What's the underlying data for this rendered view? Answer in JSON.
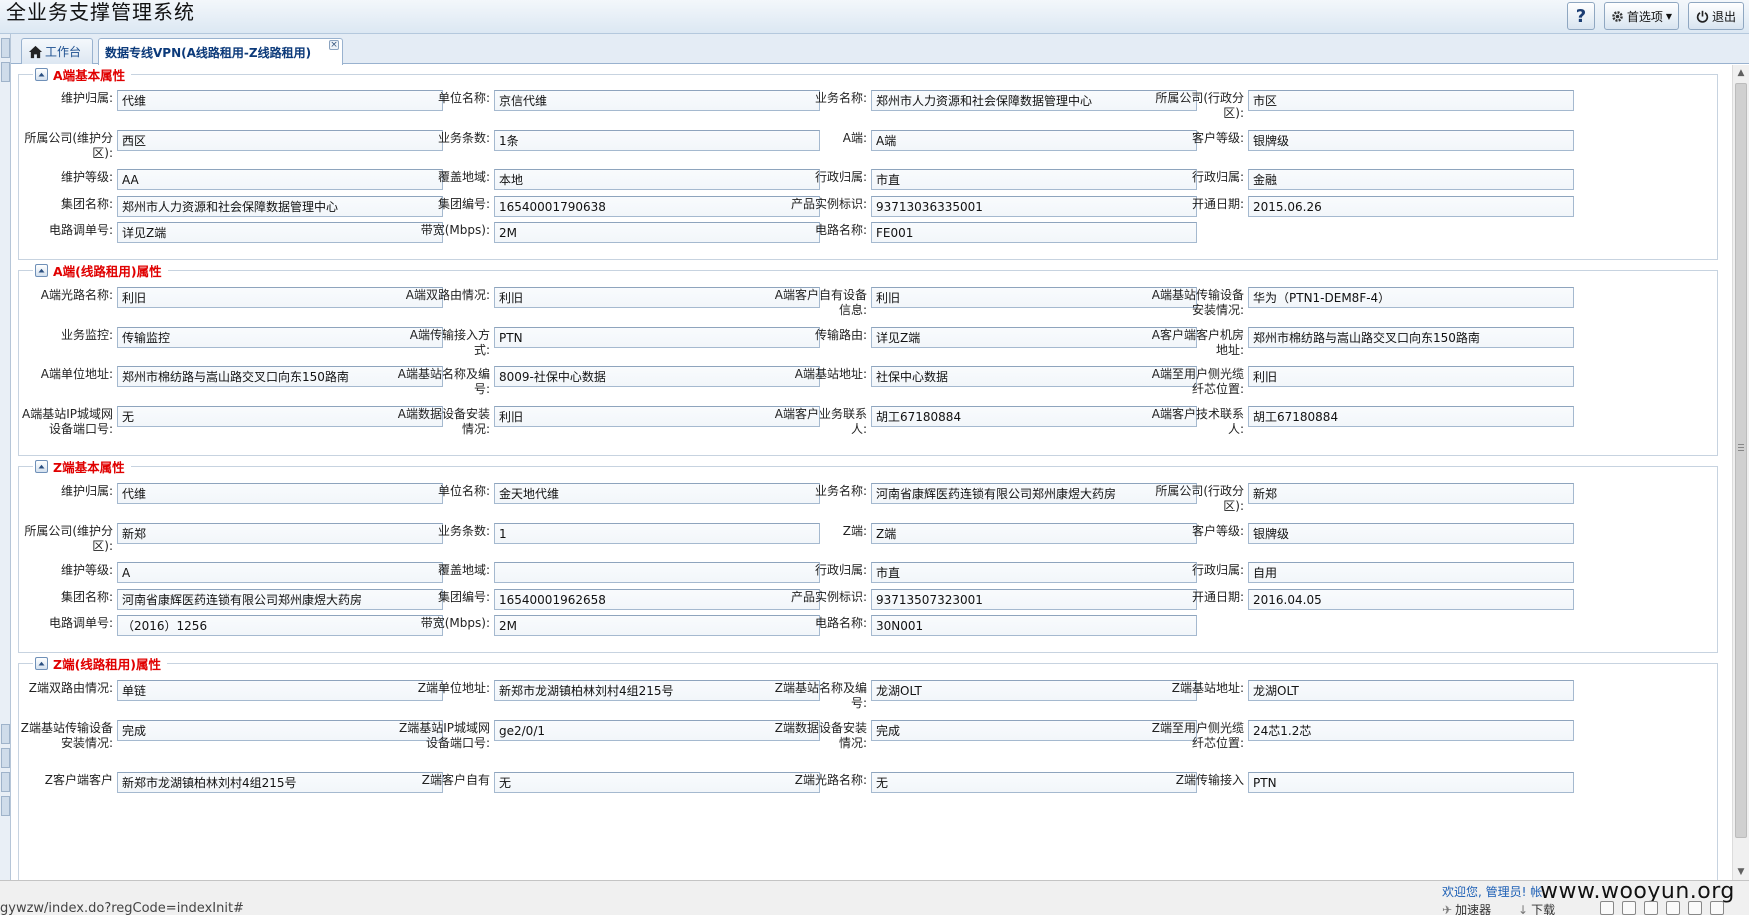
{
  "app": {
    "title": "全业务支撑管理系统"
  },
  "top_buttons": {
    "help": "?",
    "options": "首选项",
    "logout": "退出"
  },
  "tabs": [
    {
      "label": "工作台"
    },
    {
      "label": "数据专线VPN(A线路租用-Z线路租用)"
    }
  ],
  "sections": [
    {
      "title": "A端基本属性",
      "fields": [
        {
          "label": "维护归属:",
          "value": "代维"
        },
        {
          "label": "单位名称:",
          "value": "京信代维"
        },
        {
          "label": "业务名称:",
          "value": "郑州市人力资源和社会保障数据管理中心"
        },
        {
          "label": "所属公司(行政分区):",
          "value": "市区"
        },
        {
          "label": "所属公司(维护分区):",
          "value": "西区"
        },
        {
          "label": "业务条数:",
          "value": "1条"
        },
        {
          "label": "A端:",
          "value": "A端"
        },
        {
          "label": "客户等级:",
          "value": "银牌级"
        },
        {
          "label": "维护等级:",
          "value": "AA"
        },
        {
          "label": "覆盖地域:",
          "value": "本地"
        },
        {
          "label": "行政归属:",
          "value": "市直"
        },
        {
          "label": "行政归属:",
          "value": "金融"
        },
        {
          "label": "集团名称:",
          "value": "郑州市人力资源和社会保障数据管理中心"
        },
        {
          "label": "集团编号:",
          "value": "16540001790638"
        },
        {
          "label": "产品实例标识:",
          "value": "93713036335001"
        },
        {
          "label": "开通日期:",
          "value": "2015.06.26"
        },
        {
          "label": "电路调单号:",
          "value": "详见Z端"
        },
        {
          "label": "带宽(Mbps):",
          "value": "2M"
        },
        {
          "label": "电路名称:",
          "value": "FE001"
        }
      ]
    },
    {
      "title": "A端(线路租用)属性",
      "fields": [
        {
          "label": "A端光路名称:",
          "value": "利旧"
        },
        {
          "label": "A端双路由情况:",
          "value": "利旧"
        },
        {
          "label": "A端客户自有设备信息:",
          "value": "利旧"
        },
        {
          "label": "A端基站传输设备安装情况:",
          "value": "华为（PTN1-DEM8F-4）"
        },
        {
          "label": "业务监控:",
          "value": "传输监控"
        },
        {
          "label": "A端传输接入方式:",
          "value": "PTN"
        },
        {
          "label": "传输路由:",
          "value": "详见Z端"
        },
        {
          "label": "A客户端客户机房地址:",
          "value": "郑州市棉纺路与嵩山路交叉口向东150路南"
        },
        {
          "label": "A端单位地址:",
          "value": "郑州市棉纺路与嵩山路交叉口向东150路南"
        },
        {
          "label": "A端基站名称及编号:",
          "value": "8009-社保中心数据"
        },
        {
          "label": "A端基站地址:",
          "value": "社保中心数据"
        },
        {
          "label": "A端至用户侧光缆纤芯位置:",
          "value": "利旧"
        },
        {
          "label": "A端基站IP城域网设备端口号:",
          "value": "无"
        },
        {
          "label": "A端数据设备安装情况:",
          "value": "利旧"
        },
        {
          "label": "A端客户业务联系人:",
          "value": "胡工67180884"
        },
        {
          "label": "A端客户技术联系人:",
          "value": "胡工67180884"
        }
      ]
    },
    {
      "title": "Z端基本属性",
      "fields": [
        {
          "label": "维护归属:",
          "value": "代维"
        },
        {
          "label": "单位名称:",
          "value": "金天地代维"
        },
        {
          "label": "业务名称:",
          "value": "河南省康辉医药连锁有限公司郑州康煜大药房"
        },
        {
          "label": "所属公司(行政分区):",
          "value": "新郑"
        },
        {
          "label": "所属公司(维护分区):",
          "value": "新郑"
        },
        {
          "label": "业务条数:",
          "value": "1"
        },
        {
          "label": "Z端:",
          "value": "Z端"
        },
        {
          "label": "客户等级:",
          "value": "银牌级"
        },
        {
          "label": "维护等级:",
          "value": "A"
        },
        {
          "label": "覆盖地域:",
          "value": ""
        },
        {
          "label": "行政归属:",
          "value": "市直"
        },
        {
          "label": "行政归属:",
          "value": "自用"
        },
        {
          "label": "集团名称:",
          "value": "河南省康辉医药连锁有限公司郑州康煜大药房"
        },
        {
          "label": "集团编号:",
          "value": "16540001962658"
        },
        {
          "label": "产品实例标识:",
          "value": "93713507323001"
        },
        {
          "label": "开通日期:",
          "value": "2016.04.05"
        },
        {
          "label": "电路调单号:",
          "value": "（2016）1256"
        },
        {
          "label": "带宽(Mbps):",
          "value": "2M"
        },
        {
          "label": "电路名称:",
          "value": "30N001"
        }
      ]
    },
    {
      "title": "Z端(线路租用)属性",
      "fields": [
        {
          "label": "Z端双路由情况:",
          "value": "单链"
        },
        {
          "label": "Z端单位地址:",
          "value": "新郑市龙湖镇柏林刘村4组215号"
        },
        {
          "label": "Z端基站名称及编号:",
          "value": "龙湖OLT"
        },
        {
          "label": "Z端基站地址:",
          "value": "龙湖OLT"
        },
        {
          "label": "Z端基站传输设备安装情况:",
          "value": "完成"
        },
        {
          "label": "Z端基站IP城域网设备端口号:",
          "value": "ge2/0/1"
        },
        {
          "label": "Z端数据设备安装情况:",
          "value": "完成"
        },
        {
          "label": "Z端至用户侧光缆纤芯位置:",
          "value": "24芯1.2芯"
        },
        {
          "label": "Z客户端客户",
          "value": "新郑市龙湖镇柏林刘村4组215号"
        },
        {
          "label": "Z端客户自有",
          "value": "无"
        },
        {
          "label": "Z端光路名称:",
          "value": "无"
        },
        {
          "label": "Z端传输接入",
          "value": "PTN"
        }
      ]
    }
  ],
  "status": {
    "url": "gywzw/index.do?regCode=indexInit#",
    "welcome": "欢迎您, 管理员!  帐",
    "watermark": "www.wooyun.org",
    "accelerator": "加速器",
    "download": "下载"
  },
  "colors": {
    "section_title": "#e00000",
    "tab_active_text": "#0c3a7a",
    "header_bg": "#dce8f3"
  },
  "icons": [
    "help-icon",
    "gear-icon",
    "power-icon",
    "home-icon",
    "collapse-icon"
  ]
}
